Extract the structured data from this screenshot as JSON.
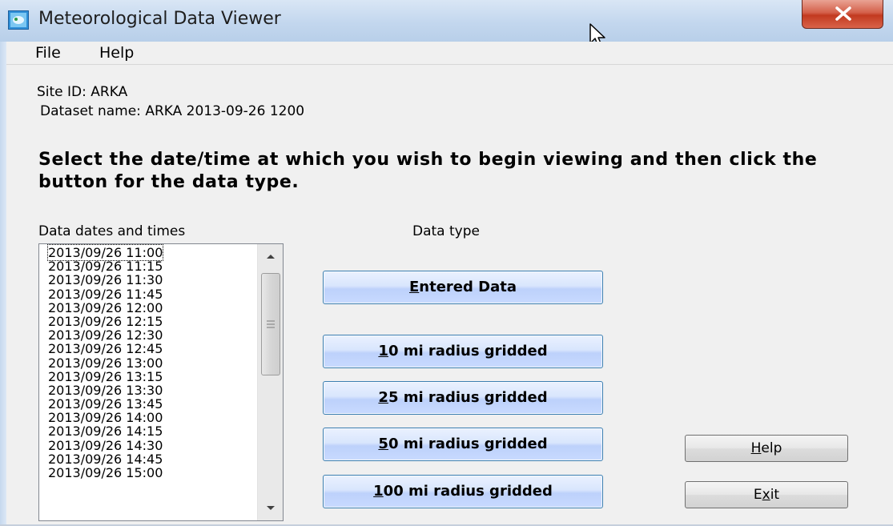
{
  "window": {
    "title": "Meteorological Data Viewer"
  },
  "menu": {
    "file": "File",
    "help": "Help"
  },
  "info": {
    "site_id": "Site ID:  ARKA",
    "dataset_name": "Dataset name: ARKA 2013-09-26 1200"
  },
  "instructions": "Select the date/time at which you wish to begin viewing and then click the button for the data type.",
  "list": {
    "label": "Data dates and times",
    "selected_index": 0,
    "items": [
      "2013/09/26 11:00",
      "2013/09/26 11:15",
      "2013/09/26 11:30",
      "2013/09/26 11:45",
      "2013/09/26 12:00",
      "2013/09/26 12:15",
      "2013/09/26 12:30",
      "2013/09/26 12:45",
      "2013/09/26 13:00",
      "2013/09/26 13:15",
      "2013/09/26 13:30",
      "2013/09/26 13:45",
      "2013/09/26 14:00",
      "2013/09/26 14:15",
      "2013/09/26 14:30",
      "2013/09/26 14:45",
      "2013/09/26 15:00"
    ]
  },
  "data_type": {
    "label": "Data type",
    "buttons": [
      {
        "mnemonic": "E",
        "rest": "ntered Data"
      },
      {
        "mnemonic": "1",
        "rest": "0 mi radius gridded"
      },
      {
        "mnemonic": "2",
        "rest": "5 mi radius gridded"
      },
      {
        "mnemonic": "5",
        "rest": "0 mi radius gridded"
      },
      {
        "mnemonic": "1",
        "rest": "00 mi radius gridded"
      }
    ]
  },
  "actions": {
    "help": {
      "mnemonic": "H",
      "rest": "elp"
    },
    "exit": {
      "pre": "E",
      "mnemonic": "x",
      "rest": "it"
    }
  },
  "colors": {
    "titlebar": "#c3d7ee",
    "close_button": "#c23a20",
    "data_button": "#c8daff",
    "window_bg": "#f0f0f0"
  }
}
